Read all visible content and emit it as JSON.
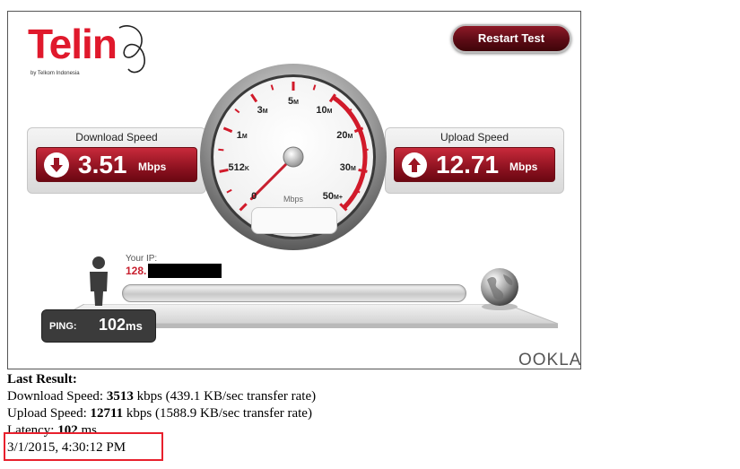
{
  "logo": {
    "text": "Telin",
    "tagline": "by Telkom Indonesia",
    "brand_color": "#e0192c"
  },
  "restart_button": {
    "label": "Restart Test"
  },
  "download": {
    "label": "Download Speed",
    "value": "3.51",
    "unit": "Mbps",
    "icon": "arrow-down-icon"
  },
  "upload": {
    "label": "Upload Speed",
    "value": "12.71",
    "unit": "Mbps",
    "icon": "arrow-up-icon"
  },
  "gauge": {
    "unit": "Mbps",
    "ticks": [
      "0",
      "512K",
      "1M",
      "3M",
      "5M",
      "10M",
      "20M",
      "30M",
      "50M+"
    ],
    "needle_tick_fraction": 0.0,
    "accent_color": "#d11a2a"
  },
  "ip": {
    "label": "Your IP:",
    "value": "128."
  },
  "ping": {
    "label": "PING:",
    "value": "102",
    "unit": "ms"
  },
  "branding": {
    "ookla": "OOKLA"
  },
  "results": {
    "heading": "Last Result:",
    "download_prefix": "Download Speed: ",
    "download_kbps": "3513",
    "download_suffix": " kbps (439.1 KB/sec transfer rate)",
    "upload_prefix": "Upload Speed: ",
    "upload_kbps": "12711",
    "upload_suffix": " kbps (1588.9 KB/sec transfer rate)",
    "latency_prefix": "Latency: ",
    "latency_ms": "102",
    "latency_suffix": " ms",
    "timestamp": "3/1/2015, 4:30:12 PM",
    "highlight_color": "#e8202d"
  }
}
